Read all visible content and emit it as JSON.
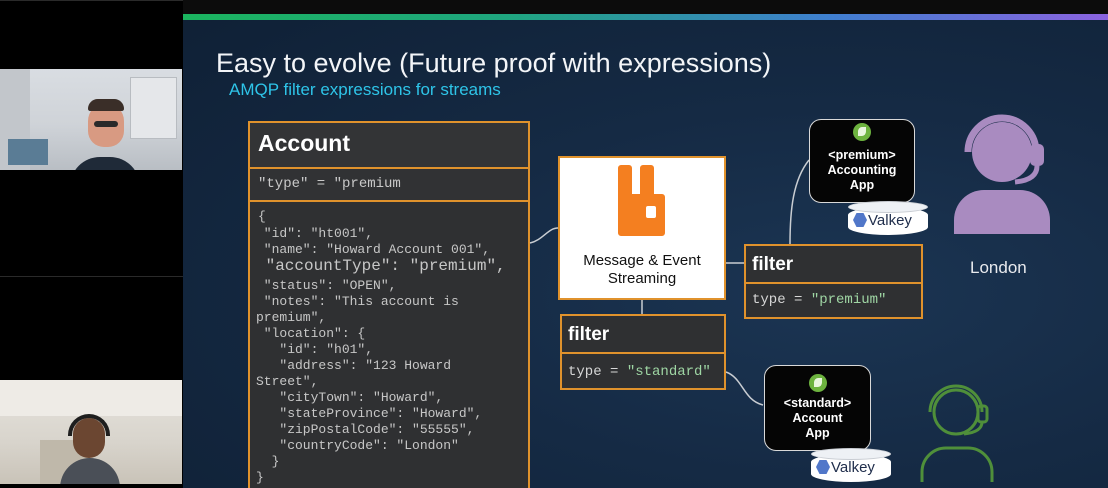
{
  "slide": {
    "title": "Easy to evolve (Future proof with expressions)",
    "subtitle": "AMQP filter expressions for streams"
  },
  "account": {
    "title": "Account",
    "filter_line": "\"type\" = \"premium",
    "json_lines": [
      "{",
      " \"id\": \"ht001\",",
      " \"name\": \"Howard Account 001\",",
      " \"accountType\": \"premium\",",
      " \"status\": \"OPEN\",",
      " \"notes\": \"This account is",
      "premium\",",
      " \"location\": {",
      "   \"id\": \"h01\",",
      "   \"address\": \"123 Howard",
      "Street\",",
      "   \"cityTown\": \"Howard\",",
      "   \"stateProvince\": \"Howard\",",
      "   \"zipPostalCode\": \"55555\",",
      "   \"countryCode\": \"London\"",
      "  }",
      "}"
    ]
  },
  "broker": {
    "label_line1": "Message & Event",
    "label_line2": "Streaming",
    "logo_color": "#f47f20"
  },
  "filter_premium": {
    "title": "filter",
    "expr_prefix": "type = ",
    "expr_value": "\"premium\""
  },
  "filter_standard": {
    "title": "filter",
    "expr_prefix": "type = ",
    "expr_value": "\"standard\""
  },
  "app_premium": {
    "line1": "<premium>",
    "line2": "Accounting",
    "line3": "App",
    "store": "Valkey"
  },
  "app_standard": {
    "line1": "<standard>",
    "line2": "Account",
    "line3": "App",
    "store": "Valkey"
  },
  "people": {
    "london_label": "London"
  },
  "colors": {
    "accent_orange": "#e0922c",
    "slide_bg": "#152a44",
    "subtitle_cyan": "#2ec4e8",
    "person_purple": "#a98bc0",
    "person_green": "#4f8f3a"
  }
}
